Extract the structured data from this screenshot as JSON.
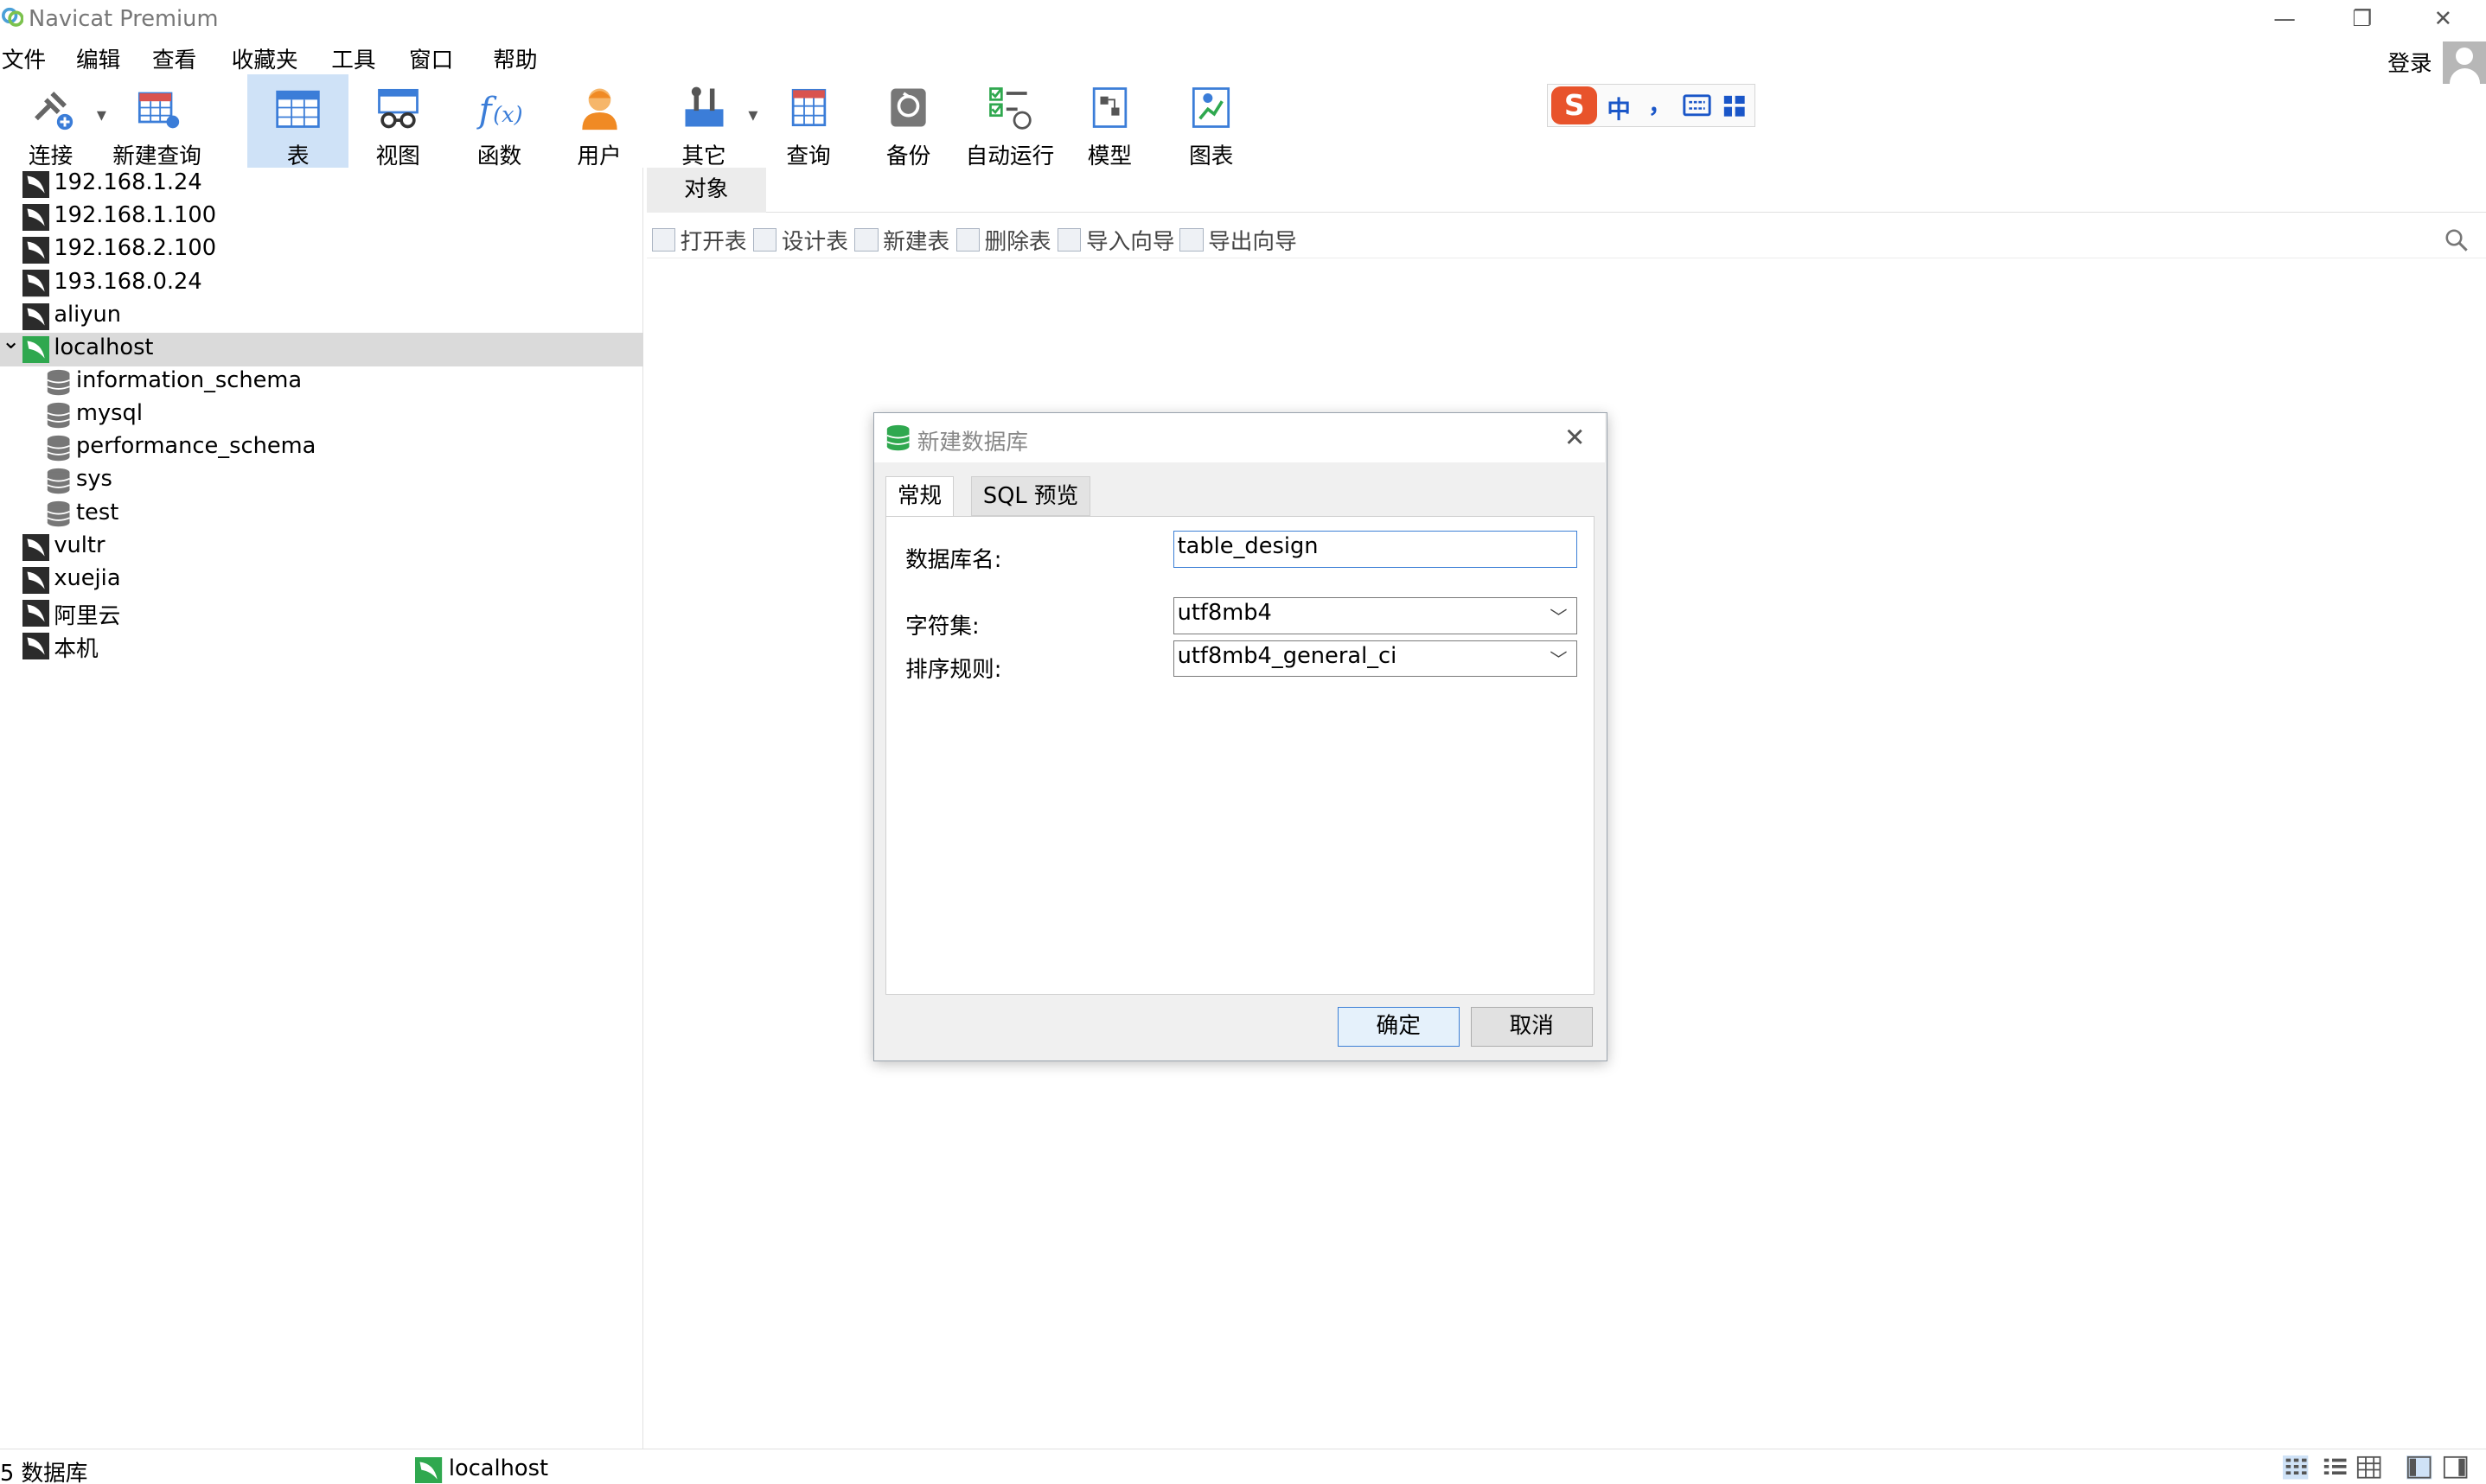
{
  "window": {
    "title": "Navicat Premium"
  },
  "menu": [
    "文件",
    "编辑",
    "查看",
    "收藏夹",
    "工具",
    "窗口",
    "帮助"
  ],
  "account": {
    "login_label": "登录"
  },
  "toolbar": {
    "connect": "连接",
    "new_query": "新建查询",
    "table": "表",
    "view": "视图",
    "function": "函数",
    "user": "用户",
    "other": "其它",
    "query": "查询",
    "backup": "备份",
    "automation": "自动运行",
    "model": "模型",
    "chart": "图表"
  },
  "ime": {
    "mode": "中",
    "punct": "，"
  },
  "sidebar": {
    "connections_top": [
      "192.168.1.24",
      "192.168.1.100",
      "192.168.2.100",
      "193.168.0.24",
      "aliyun"
    ],
    "selected_connection": "localhost",
    "databases": [
      "information_schema",
      "mysql",
      "performance_schema",
      "sys",
      "test"
    ],
    "connections_bottom": [
      "vultr",
      "xuejia",
      "阿里云",
      "本机"
    ]
  },
  "main": {
    "tab_objects": "对象",
    "object_actions": [
      "打开表",
      "设计表",
      "新建表",
      "删除表",
      "导入向导",
      "导出向导"
    ]
  },
  "status": {
    "db_count": "5 数据库",
    "connection": "localhost"
  },
  "dialog": {
    "title": "新建数据库",
    "tab_general": "常规",
    "tab_sql": "SQL 预览",
    "name_label": "数据库名:",
    "name_value": "table_design",
    "charset_label": "字符集:",
    "charset_value": "utf8mb4",
    "collation_label": "排序规则:",
    "collation_value": "utf8mb4_general_ci",
    "ok": "确定",
    "cancel": "取消"
  },
  "colors": {
    "accent": "#3c7fd6",
    "toolbar_active": "#cfe2f7",
    "selection": "#dadada",
    "db_green": "#2fa84f"
  }
}
